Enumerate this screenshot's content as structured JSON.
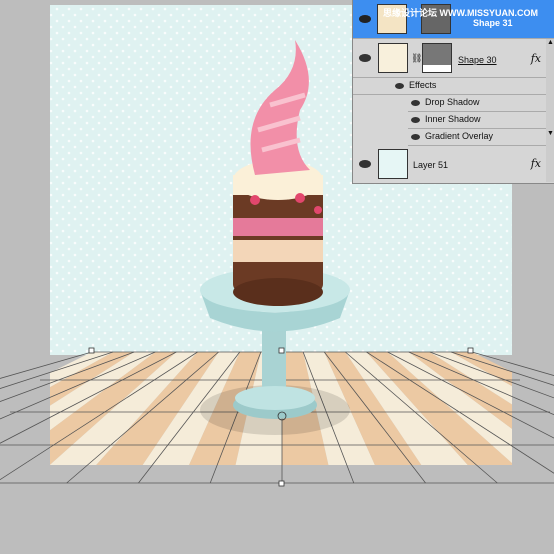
{
  "layers_panel": {
    "layers": [
      {
        "name": "Shape 31",
        "selected": true
      },
      {
        "name": "Shape 30",
        "fx": "fx"
      },
      {
        "name": "Layer 51",
        "fx": "fx"
      }
    ],
    "effects_label": "Effects",
    "effects": [
      "Drop Shadow",
      "Inner Shadow",
      "Gradient Overlay"
    ]
  },
  "watermark": "思缘设计论坛 WWW.MISSYUAN.COM",
  "colors": {
    "selection": "#3d8ef0",
    "wall": "#dff2f1",
    "floor_light": "#f5ecd9",
    "floor_dark": "#ecc9a3",
    "cake_pink": "#f28fa8",
    "chocolate": "#6b3a24"
  }
}
